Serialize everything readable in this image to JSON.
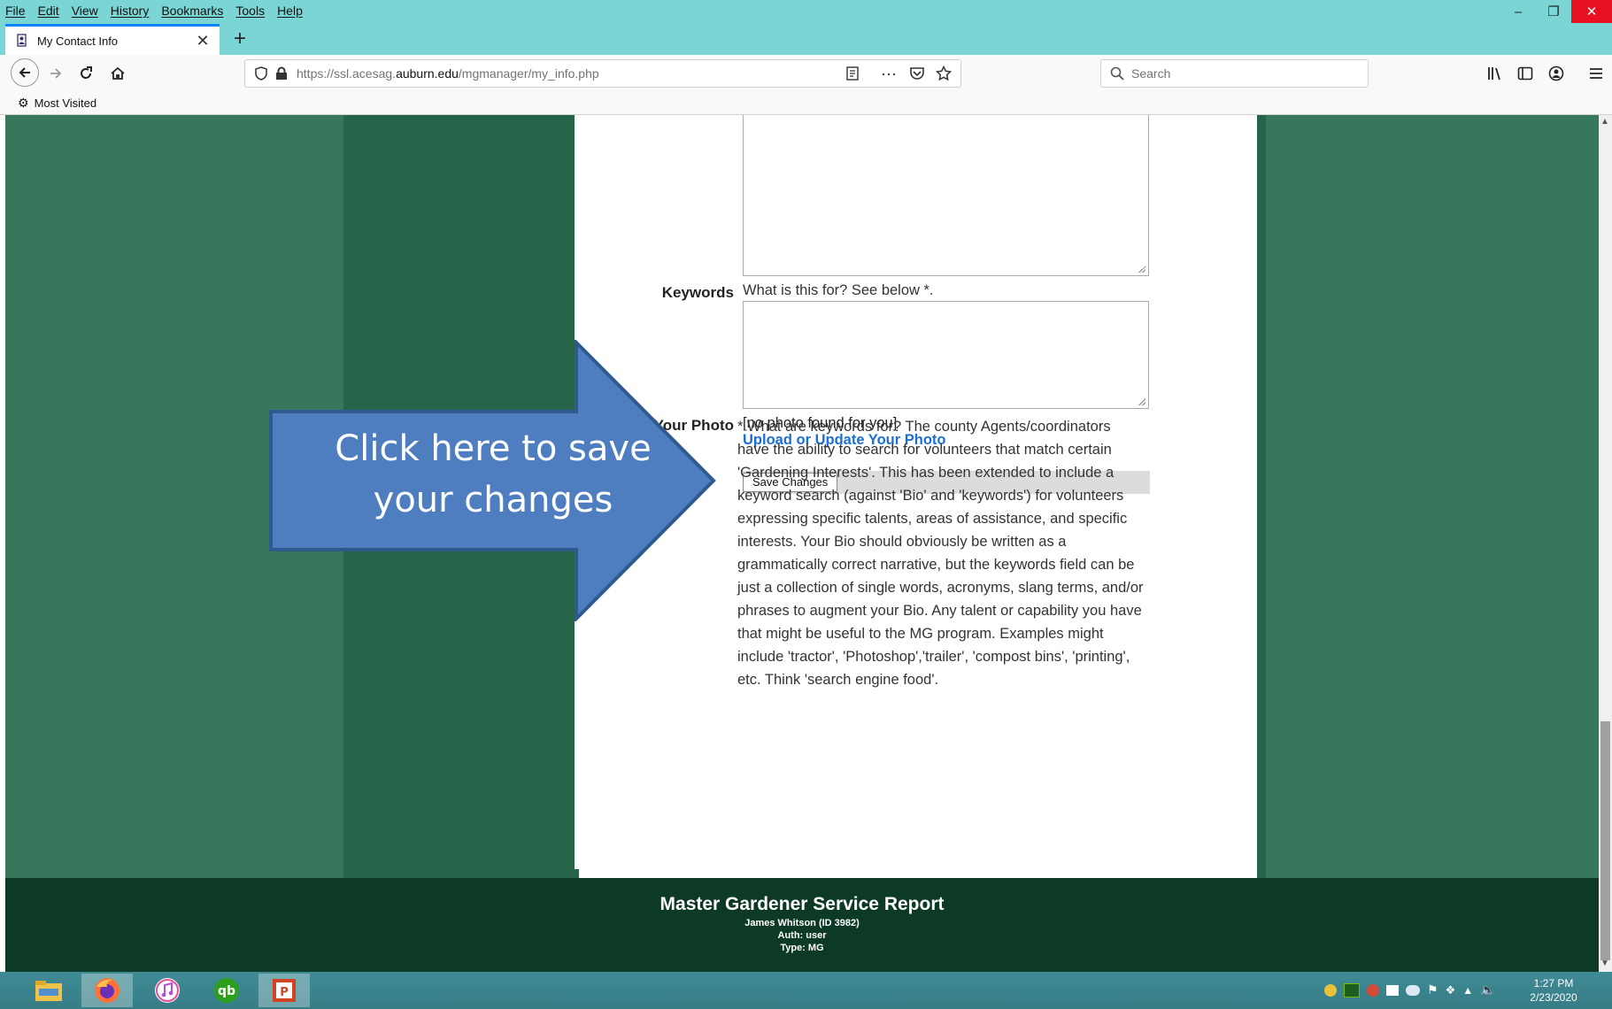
{
  "browser": {
    "menu": [
      "File",
      "Edit",
      "View",
      "History",
      "Bookmarks",
      "Tools",
      "Help"
    ],
    "tab_title": "My Contact Info",
    "url_prefix": "https://ssl.acesag.",
    "url_domain": "auburn.edu",
    "url_path": "/mgmanager/my_info.php",
    "search_placeholder": "Search",
    "bookmarks": [
      "Most Visited"
    ]
  },
  "form": {
    "keywords_label": "Keywords",
    "keywords_hint": "What is this for? See below *.",
    "photo_label": "Your Photo",
    "photo_status": "[no photo found for you]",
    "photo_link": "Upload or Update Your Photo",
    "save_button": "Save Changes",
    "notes": "* What are keywords for? The county Agents/coordinators have the ability to search for volunteers that match certain 'Gardening Interests'. This has been extended to include a keyword search (against 'Bio' and 'keywords') for volunteers expressing specific talents, areas of assistance, and specific interests. Your Bio should obviously be written as a grammatically correct narrative, but the keywords field can be just a collection of single words, acronyms, slang terms, and/or phrases to augment your Bio. Any talent or capability you have that might be useful to the MG program. Examples might include 'tractor', 'Photoshop','trailer', 'compost bins', 'printing', etc. Think 'search engine food'."
  },
  "annotation": {
    "line1": "Click here to save",
    "line2": "your changes"
  },
  "footer": {
    "title": "Master Gardener Service Report",
    "user": "James Whitson (ID 3982)",
    "auth": "Auth: user",
    "type": "Type: MG"
  },
  "taskbar": {
    "time": "1:27 PM",
    "date": "2/23/2020"
  }
}
